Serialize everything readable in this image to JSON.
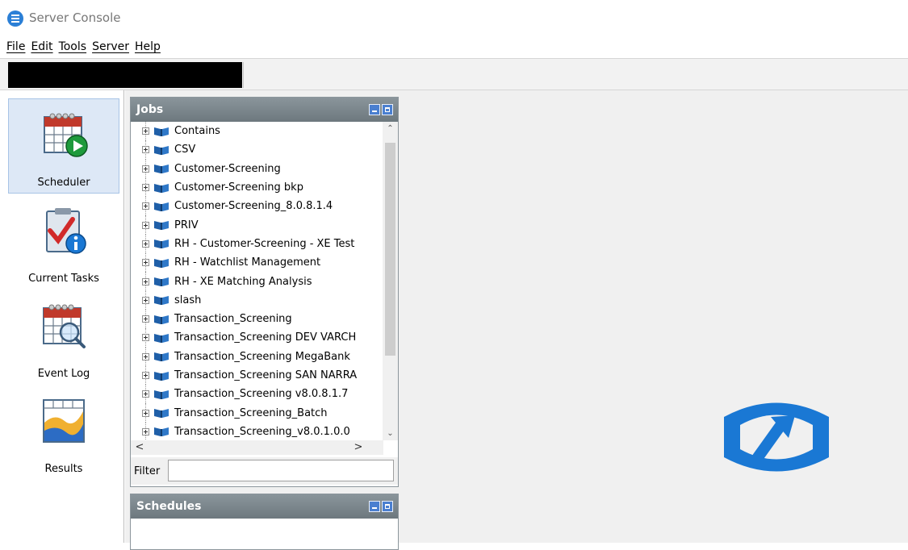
{
  "window": {
    "title": "Server Console",
    "icon": "app-menu-icon"
  },
  "menu": [
    "File",
    "Edit",
    "Tools",
    "Server",
    "Help"
  ],
  "nav": [
    {
      "label": "Scheduler",
      "icon": "calendar-play-icon",
      "active": true
    },
    {
      "label": "Current Tasks",
      "icon": "clipboard-check-info-icon",
      "active": false
    },
    {
      "label": "Event Log",
      "icon": "calendar-magnifier-icon",
      "active": false
    },
    {
      "label": "Results",
      "icon": "chart-grid-icon",
      "active": false
    }
  ],
  "jobs": {
    "title": "Jobs",
    "items": [
      "Contains",
      "CSV",
      "Customer-Screening",
      "Customer-Screening bkp",
      "Customer-Screening_8.0.8.1.4",
      "PRIV",
      "RH - Customer-Screening - XE Test",
      "RH - Watchlist Management",
      "RH - XE Matching Analysis",
      "slash",
      "Transaction_Screening",
      "Transaction_Screening DEV VARCH",
      "Transaction_Screening MegaBank",
      "Transaction_Screening SAN NARRA",
      "Transaction_Screening v8.0.8.1.7",
      "Transaction_Screening_Batch",
      "Transaction_Screening_v8.0.1.0.0"
    ],
    "filter_label": "Filter",
    "filter_value": ""
  },
  "schedules": {
    "title": "Schedules"
  },
  "colors": {
    "panel_header": "#7d888e",
    "accent_blue": "#1a78d4",
    "active_nav": "#dde8f6"
  }
}
